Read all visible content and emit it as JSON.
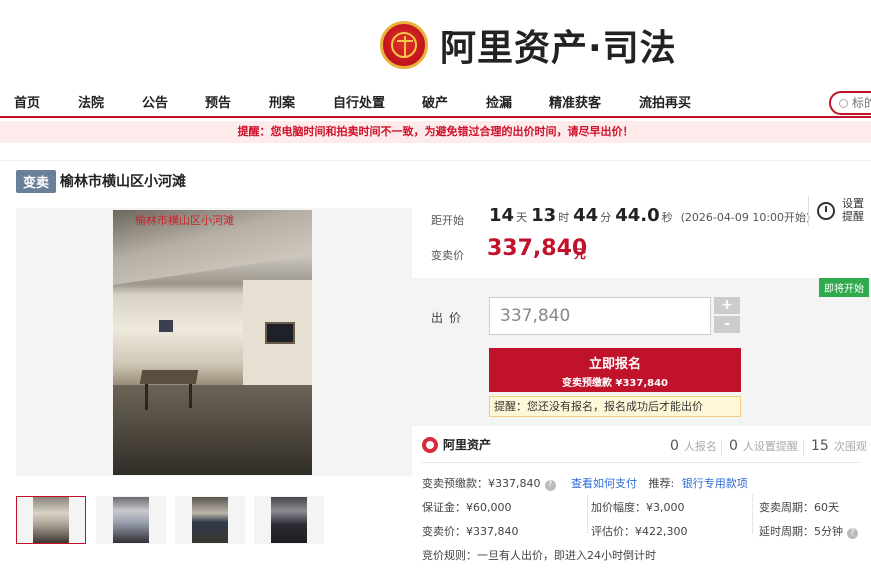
{
  "header": {
    "brand": "阿里资产·司法",
    "emblem": "court-emblem"
  },
  "nav": {
    "items": [
      "首页",
      "法院",
      "公告",
      "预告",
      "刑案",
      "自行处置",
      "破产",
      "捡漏",
      "精准获客",
      "流拍再买"
    ],
    "search_placeholder": "标的"
  },
  "notice": "提醒：您电脑时间和拍卖时间不一致，为避免错过合理的出价时间，请尽早出价！",
  "item": {
    "tag": "变卖",
    "title": "榆林市横山区小河滩",
    "watermark": "榆林市横山区小河滩"
  },
  "countdown": {
    "label": "距开始",
    "days": "14",
    "days_unit": "天",
    "hours": "13",
    "hours_unit": "时",
    "minutes": "44",
    "minutes_unit": "分",
    "seconds": "44.0",
    "seconds_unit": "秒",
    "start": "(2026-04-09 10:00开始)",
    "remind": "设置提醒"
  },
  "price": {
    "label": "变卖价",
    "value": "337,840",
    "unit": "元"
  },
  "bid": {
    "status_badge": "即将开始",
    "label": "出价",
    "input_value": "337,840",
    "plus": "+",
    "minus": "-",
    "signup_label": "立即报名",
    "signup_sub": "变卖预缴款 ¥337,840",
    "tip": "提醒：您还没有报名，报名成功后才能出价"
  },
  "stats": {
    "platform": "阿里资产",
    "signups": "0",
    "signups_label": "人报名",
    "reminders": "0",
    "reminders_label": "人设置提醒",
    "views": "15",
    "views_label": "次围观"
  },
  "info": {
    "deposit_pre": "变卖预缴款：¥337,840",
    "how_to_pay": "查看如何支付",
    "recommend_label": "推荐:",
    "bank_link": "银行专用款项",
    "bond": "保证金：¥60,000",
    "increment": "加价幅度：¥3,000",
    "period": "变卖周期：60天",
    "sell_price": "变卖价：¥337,840",
    "appraisal": "评估价：¥422,300",
    "delay": "延时周期：5分钟",
    "rule": "竞价规则：一旦有人出价，即进入24小时倒计时"
  },
  "colors": {
    "brand_red": "#c0122a",
    "tag_gray": "#6a7f9a",
    "badge_green": "#2faa4c",
    "link_blue": "#2b6bd6"
  }
}
